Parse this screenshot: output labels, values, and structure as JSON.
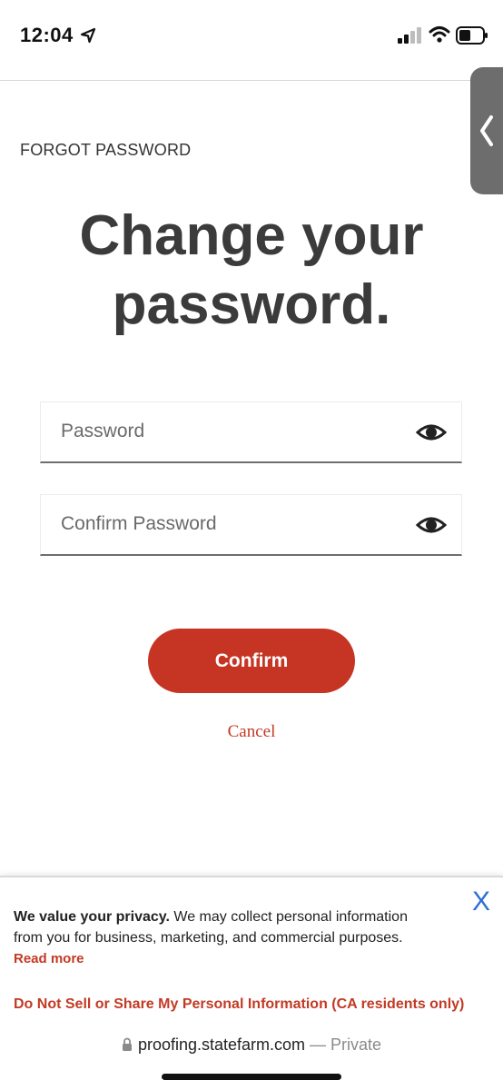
{
  "status_bar": {
    "time": "12:04"
  },
  "form": {
    "eyebrow": "FORGOT PASSWORD",
    "title_line1": "Change your",
    "title_line2": "password.",
    "password_placeholder": "Password",
    "confirm_placeholder": "Confirm Password",
    "confirm_label": "Confirm",
    "cancel_label": "Cancel"
  },
  "privacy": {
    "heading": "We value your privacy.",
    "body": " We may collect personal information from you for business, marketing, and commercial purposes.",
    "read_more": "Read more",
    "do_not_sell": "Do Not Sell or Share My Personal Information (CA residents only)",
    "close_label": "X"
  },
  "browser": {
    "domain": "proofing.statefarm.com",
    "separator": " — ",
    "mode": "Private"
  },
  "icons": {
    "location": "location-arrow-icon",
    "signal": "cellular-signal-icon",
    "wifi": "wifi-icon",
    "battery": "battery-icon",
    "side_tab": "chevron-left-icon",
    "reveal": "eye-icon",
    "lock": "lock-icon"
  },
  "colors": {
    "accent": "#c63523",
    "link": "#c23a24",
    "close": "#2b6fd6",
    "text": "#3b3b3b",
    "side_tab": "#6d6d6d"
  }
}
